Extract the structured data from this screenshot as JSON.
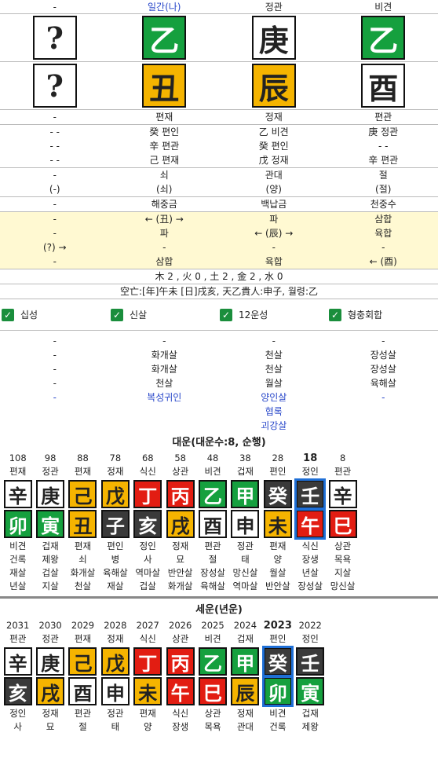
{
  "colors": {
    "green": "#15a03e",
    "yellow": "#f5b400",
    "white": "#ffffff",
    "red": "#e21d12",
    "dark": "#3a3a3a",
    "blue": "#2746c9"
  },
  "header": [
    "-",
    "일간(나)",
    "정관",
    "비견"
  ],
  "stems": [
    {
      "c": "?",
      "bg": "white",
      "fg": "#222"
    },
    {
      "c": "乙",
      "bg": "green",
      "fg": "#fff"
    },
    {
      "c": "庚",
      "bg": "white",
      "fg": "#222"
    },
    {
      "c": "乙",
      "bg": "green",
      "fg": "#fff"
    }
  ],
  "branches": [
    {
      "c": "?",
      "bg": "white",
      "fg": "#222"
    },
    {
      "c": "丑",
      "bg": "yellow",
      "fg": "#222"
    },
    {
      "c": "辰",
      "bg": "yellow",
      "fg": "#222"
    },
    {
      "c": "酉",
      "bg": "white",
      "fg": "#222"
    }
  ],
  "branch_tengods": [
    "-",
    "편재",
    "정재",
    "편관"
  ],
  "hidden": [
    [
      "- -",
      "癸 편인",
      "乙 비견",
      "庚 정관"
    ],
    [
      "- -",
      "辛 편관",
      "癸 편인",
      "- -"
    ],
    [
      "- -",
      "己 편재",
      "戊 정재",
      "辛 편관"
    ]
  ],
  "twelve": [
    [
      "-",
      "쇠",
      "관대",
      "절"
    ],
    [
      "(-)",
      "(쇠)",
      "(양)",
      "(절)"
    ]
  ],
  "napeum": [
    "-",
    "해중금",
    "백납금",
    "천중수"
  ],
  "relations": [
    [
      "-",
      "← (丑) →",
      "파",
      "삼합"
    ],
    [
      "-",
      "파",
      "← (辰) →",
      "육합"
    ],
    [
      "(?) →",
      "-",
      "-",
      "-"
    ],
    [
      "-",
      "삼합",
      "육합",
      "← (酉)"
    ]
  ],
  "elements": "木 2 , 火 0 , 土 2 , 金 2 , 水 0",
  "gongmang": "空亡:[年]午未 [日]戌亥, 天乙貴人:申子, 월령:乙",
  "checkboxes": [
    "십성",
    "신살",
    "12운성",
    "형충회합"
  ],
  "sinsal": [
    [
      "-",
      "-",
      "-",
      "-"
    ],
    [
      "-",
      "화개살",
      "천살",
      "장성살"
    ],
    [
      "-",
      "화개살",
      "천살",
      "장성살"
    ],
    [
      "-",
      "천살",
      "월살",
      "육해살"
    ],
    [
      "-",
      "복성귀인",
      "양인살",
      "-"
    ],
    [
      "",
      "",
      "협록",
      ""
    ],
    [
      "",
      "",
      "괴강살",
      ""
    ]
  ],
  "daeun_title": "대운(대운수:8, 순행)",
  "daeun": [
    {
      "age": "108",
      "tg": "편재",
      "s": "辛",
      "sbg": "white",
      "b": "卯",
      "bbg": "green",
      "r": [
        "비견",
        "건록",
        "재살",
        "년살"
      ]
    },
    {
      "age": "98",
      "tg": "정관",
      "s": "庚",
      "sbg": "white",
      "b": "寅",
      "bbg": "green",
      "r": [
        "겁재",
        "제왕",
        "겁살",
        "지살"
      ]
    },
    {
      "age": "88",
      "tg": "편재",
      "s": "己",
      "sbg": "yellow",
      "b": "丑",
      "bbg": "yellow",
      "r": [
        "편재",
        "쇠",
        "화개살",
        "천살"
      ]
    },
    {
      "age": "78",
      "tg": "정재",
      "s": "戊",
      "sbg": "yellow",
      "b": "子",
      "bbg": "dark",
      "r": [
        "편인",
        "병",
        "육해살",
        "재살"
      ]
    },
    {
      "age": "68",
      "tg": "식신",
      "s": "丁",
      "sbg": "red",
      "b": "亥",
      "bbg": "dark",
      "r": [
        "정인",
        "사",
        "역마살",
        "겁살"
      ]
    },
    {
      "age": "58",
      "tg": "상관",
      "s": "丙",
      "sbg": "red",
      "b": "戌",
      "bbg": "yellow",
      "r": [
        "정재",
        "묘",
        "반안살",
        "화개살"
      ]
    },
    {
      "age": "48",
      "tg": "비견",
      "s": "乙",
      "sbg": "green",
      "b": "酉",
      "bbg": "white",
      "r": [
        "편관",
        "절",
        "장성살",
        "육해살"
      ]
    },
    {
      "age": "38",
      "tg": "겁재",
      "s": "甲",
      "sbg": "green",
      "b": "申",
      "bbg": "white",
      "r": [
        "정관",
        "태",
        "망신살",
        "역마살"
      ]
    },
    {
      "age": "28",
      "tg": "편인",
      "s": "癸",
      "sbg": "dark",
      "b": "未",
      "bbg": "yellow",
      "r": [
        "편재",
        "양",
        "월살",
        "반안살"
      ]
    },
    {
      "age": "18",
      "tg": "정인",
      "s": "壬",
      "sbg": "dark",
      "b": "午",
      "bbg": "red",
      "r": [
        "식신",
        "장생",
        "년살",
        "장성살"
      ],
      "sel": true
    },
    {
      "age": "8",
      "tg": "편관",
      "s": "辛",
      "sbg": "white",
      "b": "巳",
      "bbg": "red",
      "r": [
        "상관",
        "목욕",
        "지살",
        "망신살"
      ]
    }
  ],
  "seun_title": "세운(년운)",
  "seun": [
    {
      "age": "2031",
      "tg": "편관",
      "s": "辛",
      "sbg": "white",
      "b": "亥",
      "bbg": "dark",
      "r": [
        "정인",
        "사"
      ]
    },
    {
      "age": "2030",
      "tg": "정관",
      "s": "庚",
      "sbg": "white",
      "b": "戌",
      "bbg": "yellow",
      "r": [
        "정재",
        "묘"
      ]
    },
    {
      "age": "2029",
      "tg": "편재",
      "s": "己",
      "sbg": "yellow",
      "b": "酉",
      "bbg": "white",
      "r": [
        "편관",
        "절"
      ]
    },
    {
      "age": "2028",
      "tg": "정재",
      "s": "戊",
      "sbg": "yellow",
      "b": "申",
      "bbg": "white",
      "r": [
        "정관",
        "태"
      ]
    },
    {
      "age": "2027",
      "tg": "식신",
      "s": "丁",
      "sbg": "red",
      "b": "未",
      "bbg": "yellow",
      "r": [
        "편재",
        "양"
      ]
    },
    {
      "age": "2026",
      "tg": "상관",
      "s": "丙",
      "sbg": "red",
      "b": "午",
      "bbg": "red",
      "r": [
        "식신",
        "장생"
      ]
    },
    {
      "age": "2025",
      "tg": "비견",
      "s": "乙",
      "sbg": "green",
      "b": "巳",
      "bbg": "red",
      "r": [
        "상관",
        "목욕"
      ]
    },
    {
      "age": "2024",
      "tg": "겁재",
      "s": "甲",
      "sbg": "green",
      "b": "辰",
      "bbg": "yellow",
      "r": [
        "정재",
        "관대"
      ]
    },
    {
      "age": "2023",
      "tg": "편인",
      "s": "癸",
      "sbg": "dark",
      "b": "卯",
      "bbg": "green",
      "r": [
        "비견",
        "건록"
      ],
      "sel": true
    },
    {
      "age": "2022",
      "tg": "정인",
      "s": "壬",
      "sbg": "dark",
      "b": "寅",
      "bbg": "green",
      "r": [
        "겁재",
        "제왕"
      ]
    }
  ]
}
